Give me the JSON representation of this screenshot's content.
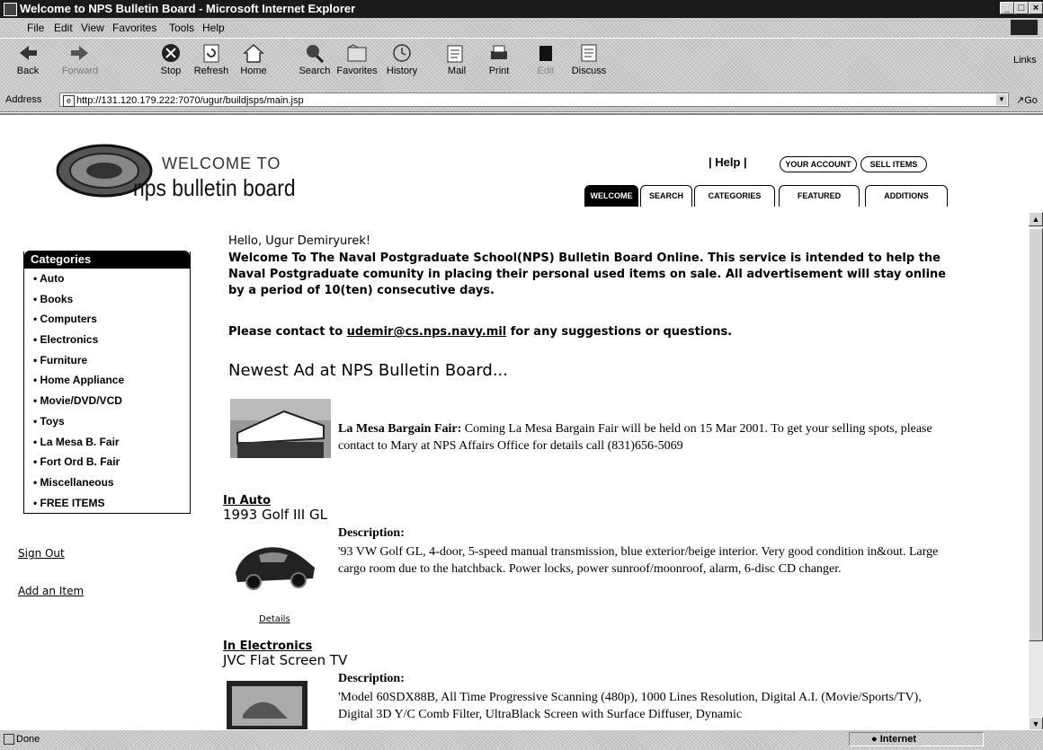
{
  "window": {
    "title": "Welcome to NPS Bulletin Board - Microsoft Internet Explorer",
    "buttons": [
      "_",
      "□",
      "×"
    ]
  },
  "menu": [
    "File",
    "Edit",
    "View",
    "Favorites",
    "Tools",
    "Help"
  ],
  "toolbar": {
    "back": "Back",
    "forward": "Forward",
    "stop": "Stop",
    "refresh": "Refresh",
    "home": "Home",
    "search": "Search",
    "favorites": "Favorites",
    "history": "History",
    "mail": "Mail",
    "print": "Print",
    "edit": "Edit",
    "discuss": "Discuss",
    "links": "Links"
  },
  "address": {
    "label": "Address",
    "url": "http://131.120.179.222:7070/ugur/buildjsps/main.jsp",
    "go": "Go"
  },
  "header": {
    "welcome_to": "WELCOME TO",
    "site_name": "nps bulletin board",
    "help": "Help",
    "your_account": "YOUR ACCOUNT",
    "sell_items": "SELL ITEMS",
    "tabs": [
      "WELCOME",
      "SEARCH",
      "CATEGORIES",
      "FEATURED",
      "ADDITIONS"
    ]
  },
  "sidebar": {
    "categories_title": "Categories",
    "categories": [
      "Auto",
      "Books",
      "Computers",
      "Electronics",
      "Furniture",
      "Home Appliance",
      "Movie/DVD/VCD",
      "Toys",
      "La Mesa B. Fair",
      "Fort Ord B. Fair",
      "Miscellaneous",
      "FREE ITEMS"
    ],
    "sign_out": "Sign Out",
    "add_item": "Add an Item"
  },
  "main": {
    "greeting": "Hello, Ugur Demiryurek!",
    "intro": "Welcome To The Naval Postgraduate School(NPS) Bulletin Board Online. This service is intended to help the Naval Postgraduate comunity in placing their personal used items on sale. All advertisement will stay online by a period of 10(ten) consecutive days.",
    "contact_prefix": "Please contact to ",
    "contact_email": "udemir@cs.nps.navy.mil",
    "contact_suffix": " for any suggestions or questions.",
    "newest_heading": "Newest Ad at NPS Bulletin Board...",
    "newest_title": "La Mesa Bargain Fair:",
    "newest_text": "Coming La Mesa Bargain Fair will be held on 15 Mar 2001. To get your selling spots, please contact to Mary at NPS Affairs Office for details call (831)656-5069",
    "listings": [
      {
        "category": "In Auto",
        "title": "1993 Golf III GL",
        "desc_label": "Description:",
        "desc": "'93 VW Golf GL, 4-door, 5-speed manual transmission, blue exterior/beige interior. Very good condition in&out. Large cargo room due to the hatchback. Power locks, power sunroof/moonroof, alarm, 6-disc CD changer.",
        "details": "Details"
      },
      {
        "category": "In Electronics",
        "title": "JVC Flat Screen TV",
        "desc_label": "Description:",
        "desc": "'Model 60SDX88B, All Time Progressive Scanning (480p), 1000 Lines Resolution, Digital A.I. (Movie/Sports/TV), Digital 3D Y/C Comb Filter, UltraBlack Screen with Surface Diffuser, Dynamic"
      }
    ]
  },
  "status": {
    "text": "Done",
    "zone": "Internet"
  }
}
